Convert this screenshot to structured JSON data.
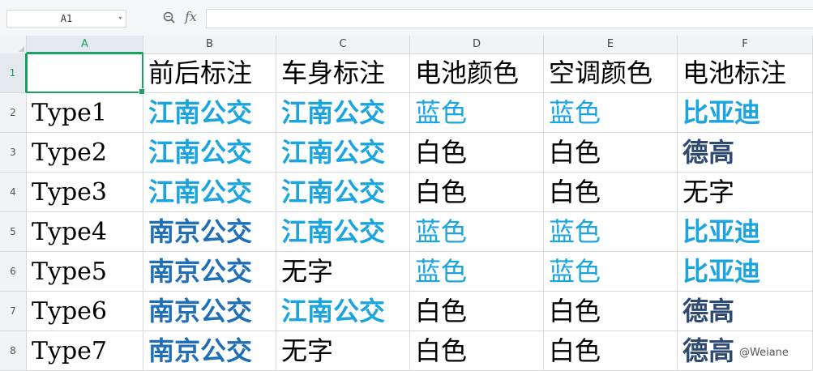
{
  "formula_bar": {
    "cell_ref": "A1",
    "fx_label": "fx",
    "formula": ""
  },
  "columns": [
    "A",
    "B",
    "C",
    "D",
    "E",
    "F"
  ],
  "rows": [
    "1",
    "2",
    "3",
    "4",
    "5",
    "6",
    "7",
    "8"
  ],
  "grid": [
    [
      "",
      "前后标注",
      "车身标注",
      "电池颜色",
      "空调颜色",
      "电池标注"
    ],
    [
      "Type1",
      "江南公交",
      "江南公交",
      "蓝色",
      "蓝色",
      "比亚迪"
    ],
    [
      "Type2",
      "江南公交",
      "江南公交",
      "白色",
      "白色",
      "德高"
    ],
    [
      "Type3",
      "江南公交",
      "江南公交",
      "白色",
      "白色",
      "无字"
    ],
    [
      "Type4",
      "南京公交",
      "江南公交",
      "蓝色",
      "蓝色",
      "比亚迪"
    ],
    [
      "Type5",
      "南京公交",
      "无字",
      "蓝色",
      "蓝色",
      "比亚迪"
    ],
    [
      "Type6",
      "南京公交",
      "江南公交",
      "白色",
      "白色",
      "德高"
    ],
    [
      "Type7",
      "南京公交",
      "无字",
      "白色",
      "白色",
      "德高"
    ]
  ],
  "watermark": "@Weiane",
  "colors": {
    "selection": "#1aa260",
    "jiangnan_style": "#1aa5e0",
    "nanjing_style": "#1f6fb8",
    "degao_style": "#2f4a70"
  },
  "icons": {
    "zoom": "zoom-icon",
    "dropdown": "chevron-down-icon"
  }
}
